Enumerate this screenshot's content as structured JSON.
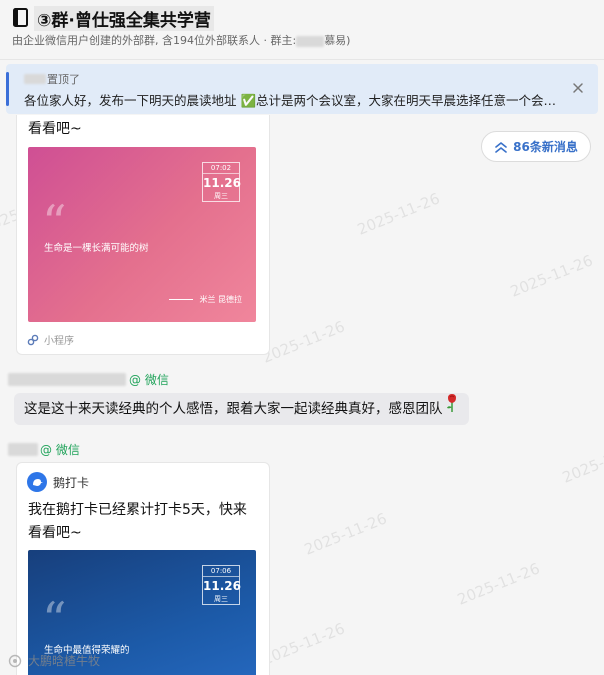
{
  "header": {
    "title": "③群·曾仕强全集共学营",
    "subtitle_prefix": "由企业微信用户创建的外部群, 含194位外部联系人 · 群主:",
    "subtitle_suffix": "慕易)"
  },
  "pinned": {
    "pinned_by_suffix": "置顶了",
    "text": "各位家人好，发布一下明天的晨读地址 ✅总计是两个会议室，大家在明天早晨选择任意一个会议室..."
  },
  "watermark_text": "2025-11-26",
  "new_messages": {
    "label": "86条新消息"
  },
  "messages": [
    {
      "type": "mini_program",
      "text_tail": "看看吧~",
      "image": {
        "date_time": "07:02",
        "date": "11.26",
        "weekday": "周三",
        "quote": "生命是一棵长满可能的树",
        "author": "米兰  昆德拉"
      },
      "mini_label": "小程序"
    },
    {
      "type": "text",
      "sender_suffix": "@ 微信",
      "text": "这是这十来天读经典的个人感悟，跟着大家一起读经典真好，感恩团队"
    },
    {
      "type": "mini_program",
      "sender_suffix": "@ 微信",
      "app_name": "鹅打卡",
      "text_line1": "我在鹅打卡已经累计打卡5天，快来",
      "text_line2": "看看吧~",
      "image": {
        "date_time": "07:06",
        "date": "11.26",
        "weekday": "周三",
        "quote": "生命中最值得荣耀的"
      }
    }
  ],
  "footer_watermark": "大鹏晗楂牛牧",
  "colors": {
    "accent_blue": "#3971c9",
    "wechat_green": "#20a35a",
    "pin_bg": "#e1ebf8",
    "bubble_bg": "#e9e9ec"
  }
}
